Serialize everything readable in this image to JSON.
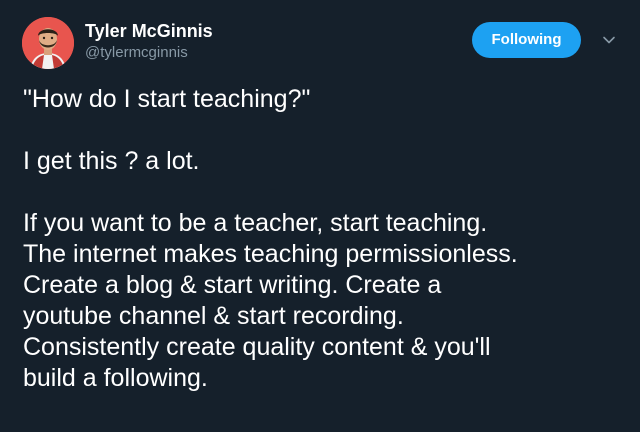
{
  "author": {
    "display_name": "Tyler McGinnis",
    "handle": "@tylermcginnis"
  },
  "follow_button": {
    "label": "Following"
  },
  "icons": {
    "menu": "chevron-down-icon"
  },
  "colors": {
    "background": "#15202b",
    "accent": "#1da1f2",
    "secondary_text": "#8899a6",
    "avatar_bg": "#e8554e"
  },
  "tweet": {
    "lines": [
      "\"How do I start teaching?\"",
      "",
      "I get this ? a lot.",
      "",
      "If you want to be a teacher, start teaching.",
      "The internet makes teaching permissionless.",
      "Create a blog & start writing. Create a",
      "youtube channel & start recording.",
      "Consistently create quality content & you'll",
      "build a following."
    ]
  }
}
